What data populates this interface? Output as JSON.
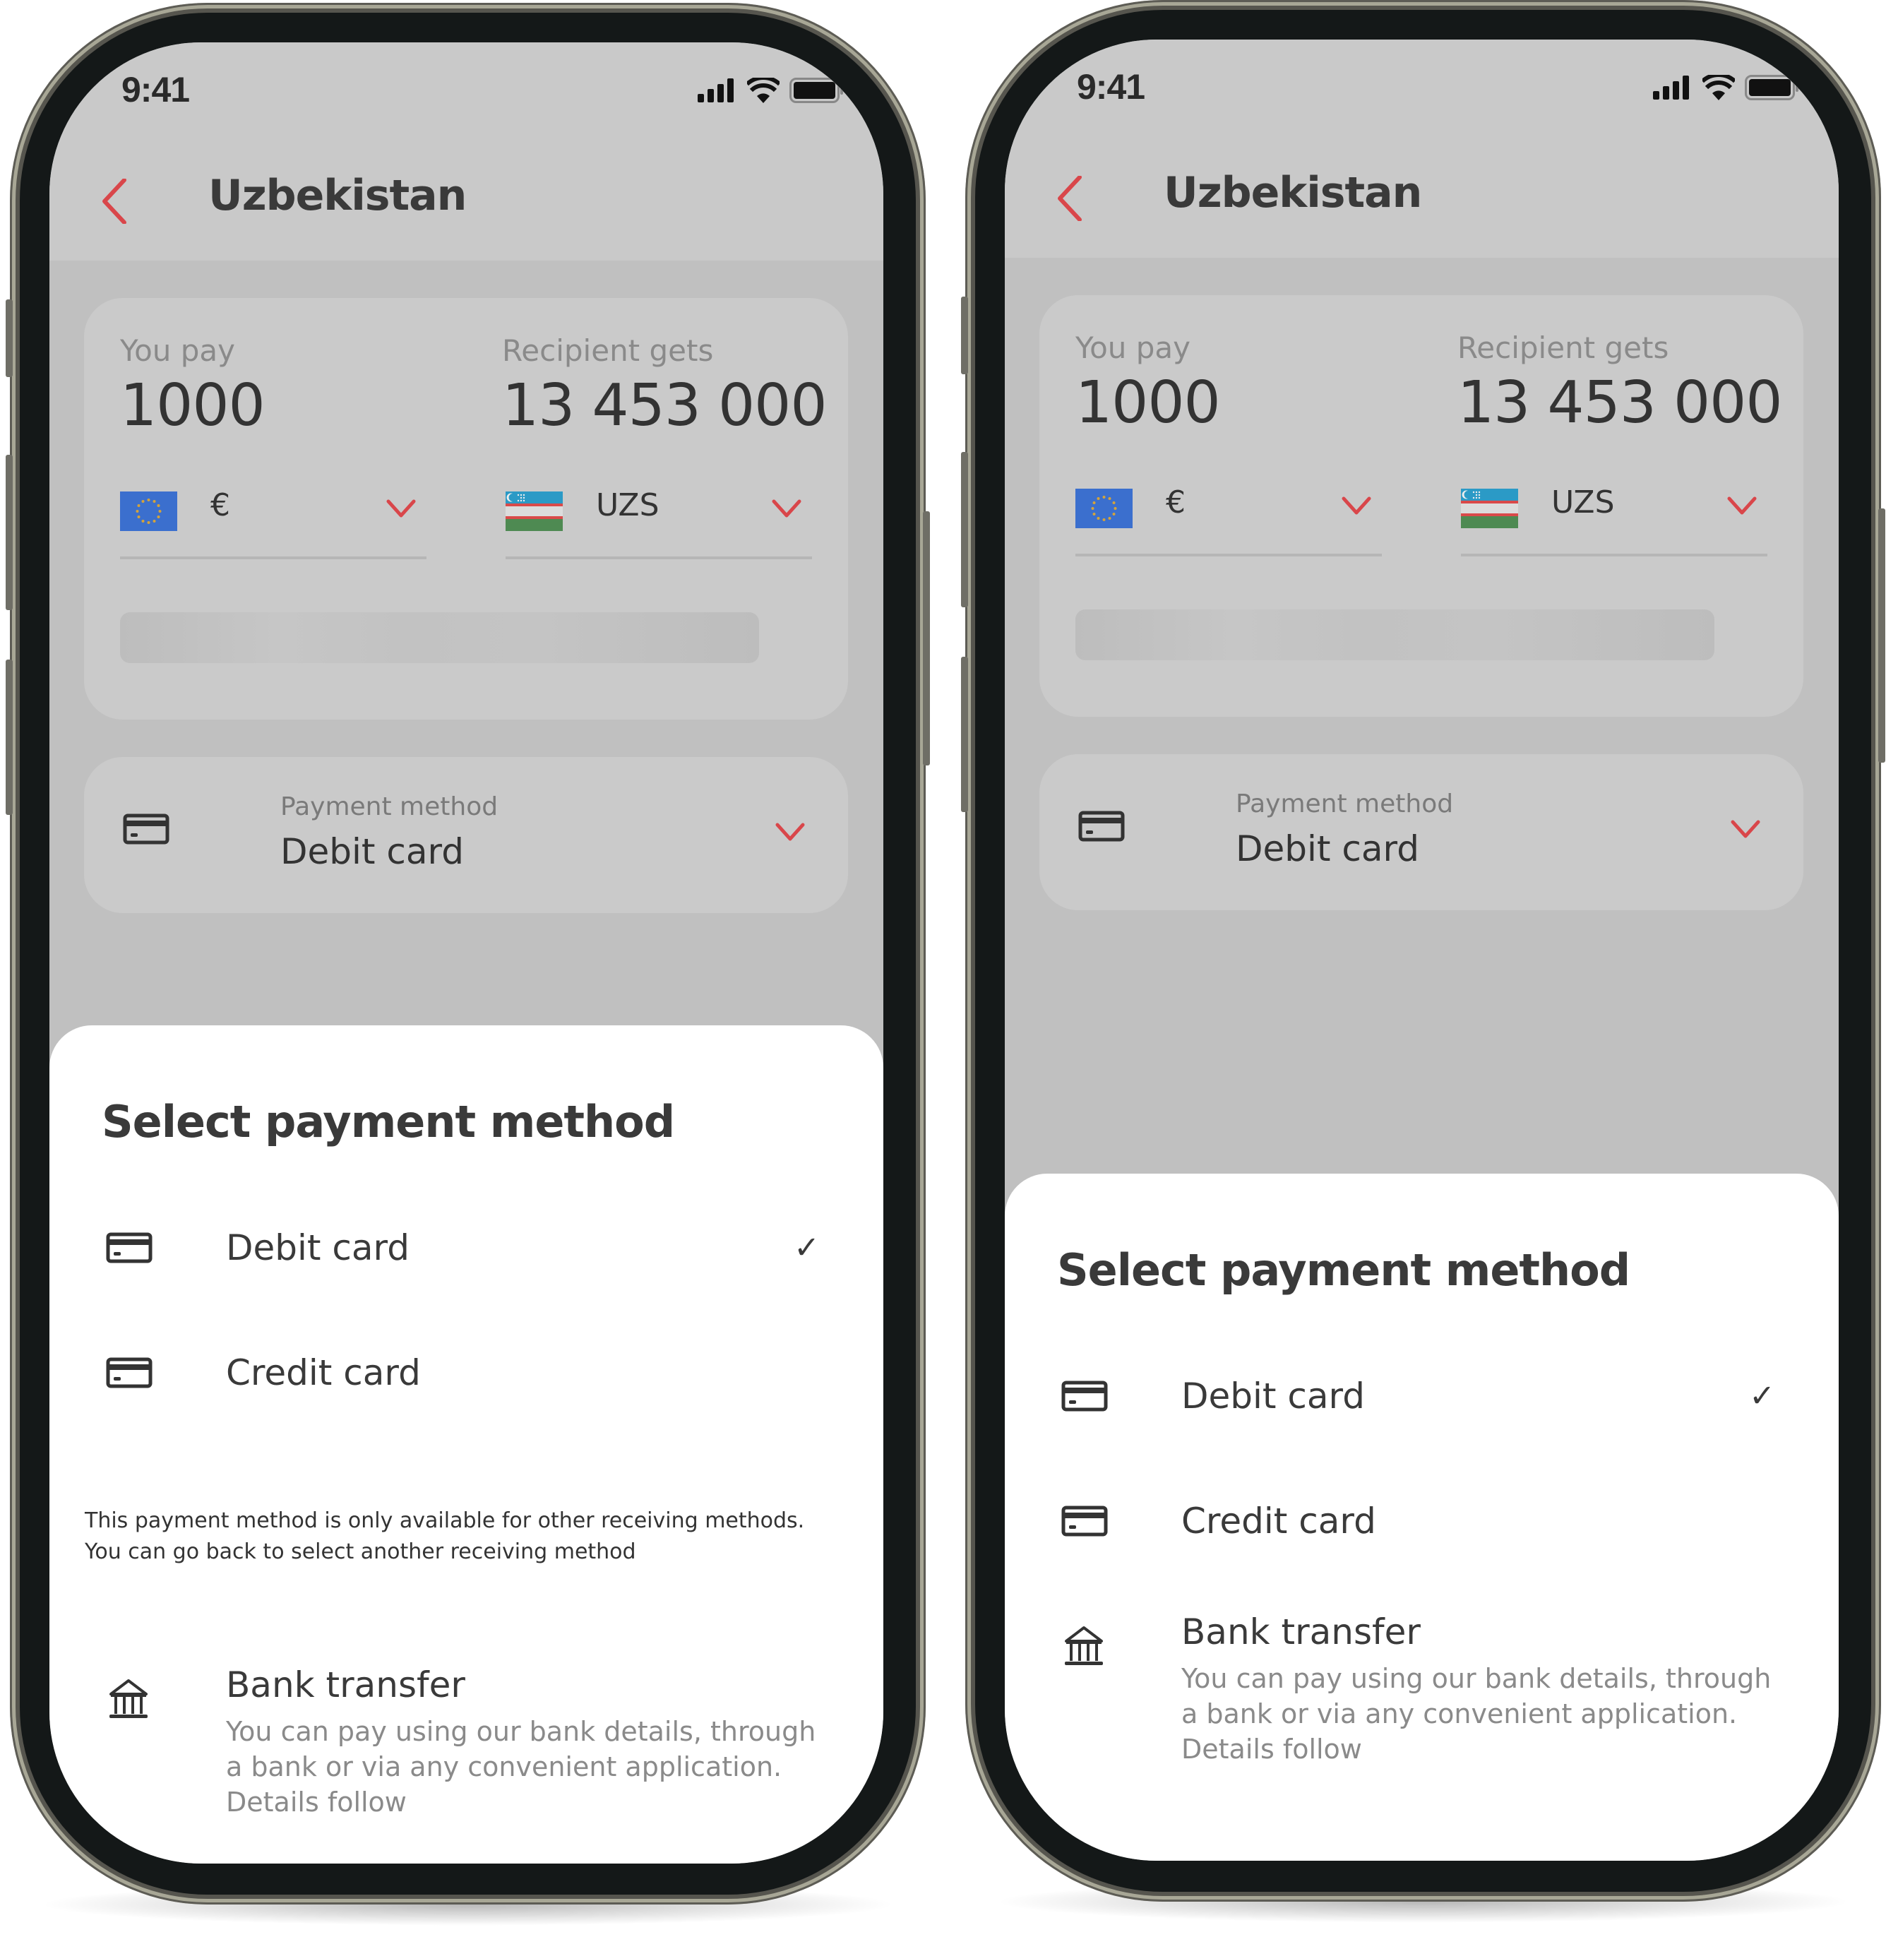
{
  "screens": [
    {
      "status_bar": {
        "time": "9:41"
      },
      "header": {
        "title": "Uzbekistan",
        "back_icon": "chevron-left-icon"
      },
      "amount_card": {
        "pay_label": "You pay",
        "pay_value": "1000",
        "pay_currency": "€",
        "pay_flag": "eu-flag-icon",
        "receive_label": "Recipient gets",
        "receive_value": "13 453 000",
        "receive_currency": "UZS",
        "receive_flag": "uzbekistan-flag-icon"
      },
      "payment_method": {
        "label": "Payment method",
        "value": "Debit card"
      },
      "sheet": {
        "title": "Select payment method",
        "options": [
          {
            "label": "Debit card",
            "icon": "card-icon",
            "selected": true
          },
          {
            "label": "Credit card",
            "icon": "card-icon",
            "selected": false
          }
        ],
        "note": "This payment method is only available for other receiving methods. You can go back to select another receiving method",
        "bank_transfer": {
          "title": "Bank transfer",
          "description": "You can pay using our bank details, through a bank or via any convenient application. Details follow",
          "icon": "bank-icon"
        },
        "check_glyph": "✓"
      }
    },
    {
      "status_bar": {
        "time": "9:41"
      },
      "header": {
        "title": "Uzbekistan",
        "back_icon": "chevron-left-icon"
      },
      "amount_card": {
        "pay_label": "You pay",
        "pay_value": "1000",
        "pay_currency": "€",
        "pay_flag": "eu-flag-icon",
        "receive_label": "Recipient gets",
        "receive_value": "13 453 000",
        "receive_currency": "UZS",
        "receive_flag": "uzbekistan-flag-icon"
      },
      "payment_method": {
        "label": "Payment method",
        "value": "Debit card"
      },
      "sheet": {
        "title": "Select payment method",
        "options": [
          {
            "label": "Debit card",
            "icon": "card-icon",
            "selected": true
          },
          {
            "label": "Credit card",
            "icon": "card-icon",
            "selected": false
          }
        ],
        "bank_transfer": {
          "title": "Bank transfer",
          "description": "You can pay using our bank details, through a bank or via any convenient application. Details follow",
          "icon": "bank-icon"
        },
        "check_glyph": "✓"
      }
    }
  ],
  "colors": {
    "accent": "#d9464a",
    "overlay_background": "#c0c0c0",
    "card_background": "#cacaca",
    "sheet_background": "#ffffff",
    "text_primary": "#3a3a3a",
    "text_secondary": "#8a8a8a"
  }
}
